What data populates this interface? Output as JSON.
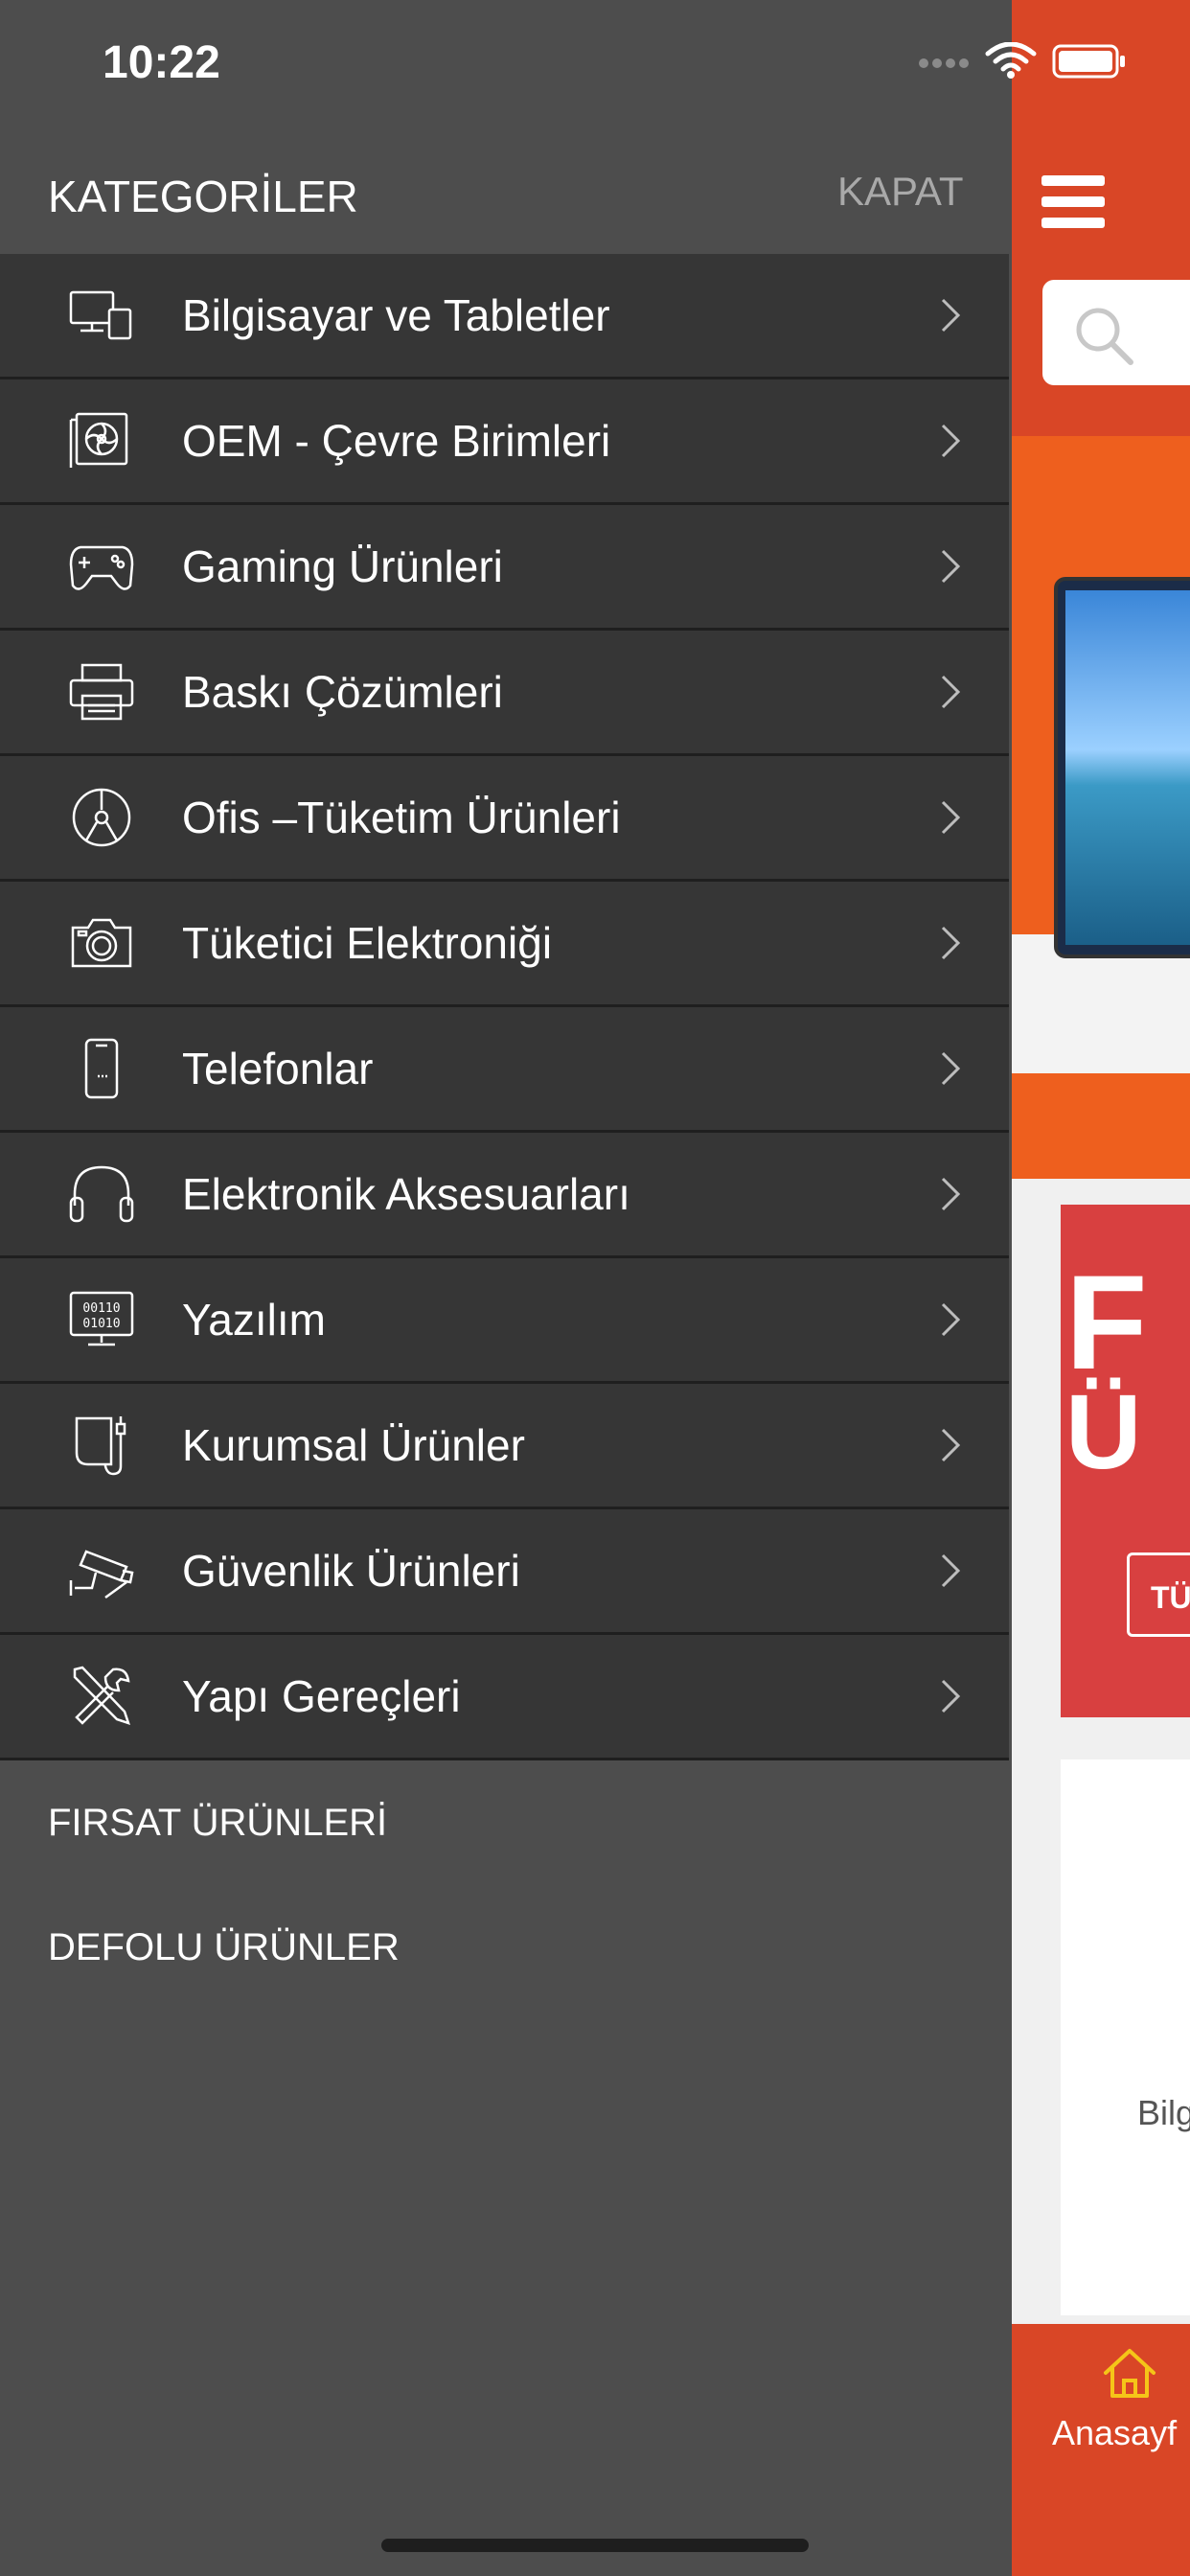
{
  "status_bar": {
    "time": "10:22"
  },
  "drawer": {
    "title": "KATEGORİLER",
    "close_label": "KAPAT",
    "categories": [
      {
        "label": "Bilgisayar ve Tabletler",
        "icon": "computer-tablet-icon"
      },
      {
        "label": "OEM - Çevre Birimleri",
        "icon": "graphics-card-icon"
      },
      {
        "label": "Gaming Ürünleri",
        "icon": "gamepad-icon"
      },
      {
        "label": "Baskı Çözümleri",
        "icon": "printer-icon"
      },
      {
        "label": "Ofis –Tüketim Ürünleri",
        "icon": "disc-icon"
      },
      {
        "label": "Tüketici Elektroniği",
        "icon": "camera-icon"
      },
      {
        "label": "Telefonlar",
        "icon": "phone-icon"
      },
      {
        "label": "Elektronik Aksesuarları",
        "icon": "headphones-icon"
      },
      {
        "label": "Yazılım",
        "icon": "software-monitor-icon"
      },
      {
        "label": "Kurumsal Ürünler",
        "icon": "device-cable-icon"
      },
      {
        "label": "Güvenlik Ürünleri",
        "icon": "security-camera-icon"
      },
      {
        "label": "Yapı Gereçleri",
        "icon": "tools-icon"
      }
    ],
    "extras": [
      {
        "label": "FIRSAT ÜRÜNLERİ"
      },
      {
        "label": "DEFOLU ÜRÜNLER"
      }
    ]
  },
  "background_app": {
    "promo_text_line1": "F",
    "promo_text_line2": "Ü",
    "promo_button_label": "TÜ",
    "card_label": "Bilg",
    "tabbar_home_label": "Anasayf"
  },
  "colors": {
    "brand": "#d94626",
    "banner": "#ee5f1e",
    "promo": "#d84040",
    "drawer_bg": "#4d4d4d",
    "row_bg": "#363636",
    "close_text": "#a9a9a9",
    "home_icon": "#f5c518"
  }
}
